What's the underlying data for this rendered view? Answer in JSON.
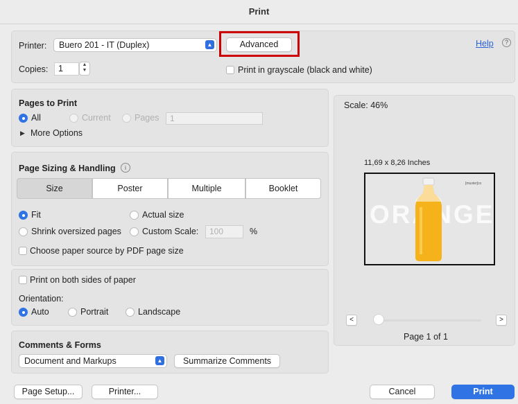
{
  "window": {
    "title": "Print"
  },
  "top": {
    "printer_label": "Printer:",
    "printer_value": "Buero 201 - IT (Duplex)",
    "advanced_label": "Advanced",
    "help_label": "Help",
    "help_icon": "?",
    "copies_label": "Copies:",
    "copies_value": "1",
    "grayscale_label": "Print in grayscale (black and white)",
    "grayscale_checked": false,
    "highlight_color": "#cc0000"
  },
  "pages_to_print": {
    "title": "Pages to Print",
    "all_label": "All",
    "current_label": "Current",
    "pages_label": "Pages",
    "pages_value": "1",
    "selected": "All",
    "more_options_label": "More Options"
  },
  "sizing": {
    "title": "Page Sizing & Handling",
    "info_icon": "i",
    "tabs": [
      "Size",
      "Poster",
      "Multiple",
      "Booklet"
    ],
    "selected_tab": "Size",
    "fit_label": "Fit",
    "actual_size_label": "Actual size",
    "shrink_label": "Shrink oversized pages",
    "custom_scale_label": "Custom Scale:",
    "custom_scale_value": "100",
    "percent_label": "%",
    "selected_option": "Fit",
    "paper_source_label": "Choose paper source by PDF page size"
  },
  "orientation": {
    "both_sides_label": "Print on both sides of paper",
    "title": "Orientation:",
    "auto_label": "Auto",
    "portrait_label": "Portrait",
    "landscape_label": "Landscape",
    "selected": "Auto"
  },
  "comments": {
    "title": "Comments & Forms",
    "select_value": "Document and Markups",
    "summarize_label": "Summarize Comments"
  },
  "preview": {
    "scale_label": "Scale:  46%",
    "size_label": "11,69 x 8,26 Inches",
    "image_text": "ORANGE",
    "brand_tag": "[muster]co",
    "prev_label": "<",
    "next_label": ">",
    "page_label": "Page 1 of 1"
  },
  "bottom": {
    "page_setup_label": "Page Setup...",
    "printer_label": "Printer...",
    "cancel_label": "Cancel",
    "print_label": "Print",
    "accent": "#2f73e4"
  }
}
